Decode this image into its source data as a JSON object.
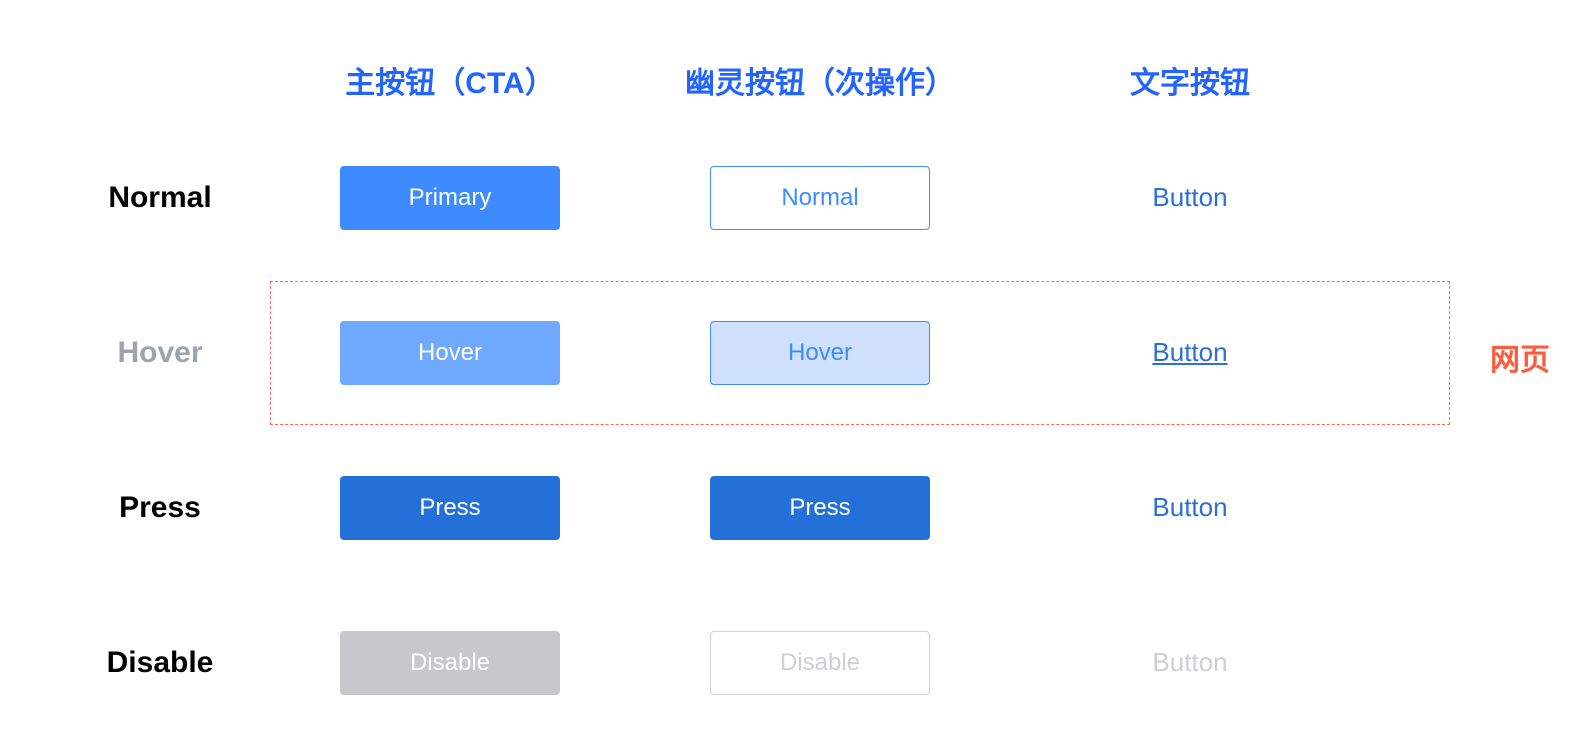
{
  "headers": {
    "primary": "主按钮（CTA）",
    "ghost": "幽灵按钮（次操作）",
    "text": "文字按钮"
  },
  "rows": {
    "normal": "Normal",
    "hover": "Hover",
    "press": "Press",
    "disable": "Disable"
  },
  "buttons": {
    "primary": {
      "normal": "Primary",
      "hover": "Hover",
      "press": "Press",
      "disable": "Disable"
    },
    "ghost": {
      "normal": "Normal",
      "hover": "Hover",
      "press": "Press",
      "disable": "Disable"
    },
    "text": {
      "normal": "Button",
      "hover": "Button",
      "press": "Button",
      "disable": "Button"
    }
  },
  "annotations": {
    "webpage": "网页"
  },
  "colors": {
    "header_blue": "#2364ff",
    "primary_normal": "#3d8bff",
    "primary_hover": "#6ea8ff",
    "primary_press": "#2370d9",
    "disabled_bg": "#c7c7cc",
    "disabled_text": "#cfcfd4",
    "ghost_hover_bg": "#cfe0fc",
    "text_btn": "#2a6fd6",
    "annotation_red": "#ff5a3c",
    "dashed_border": "#ff6b57"
  }
}
